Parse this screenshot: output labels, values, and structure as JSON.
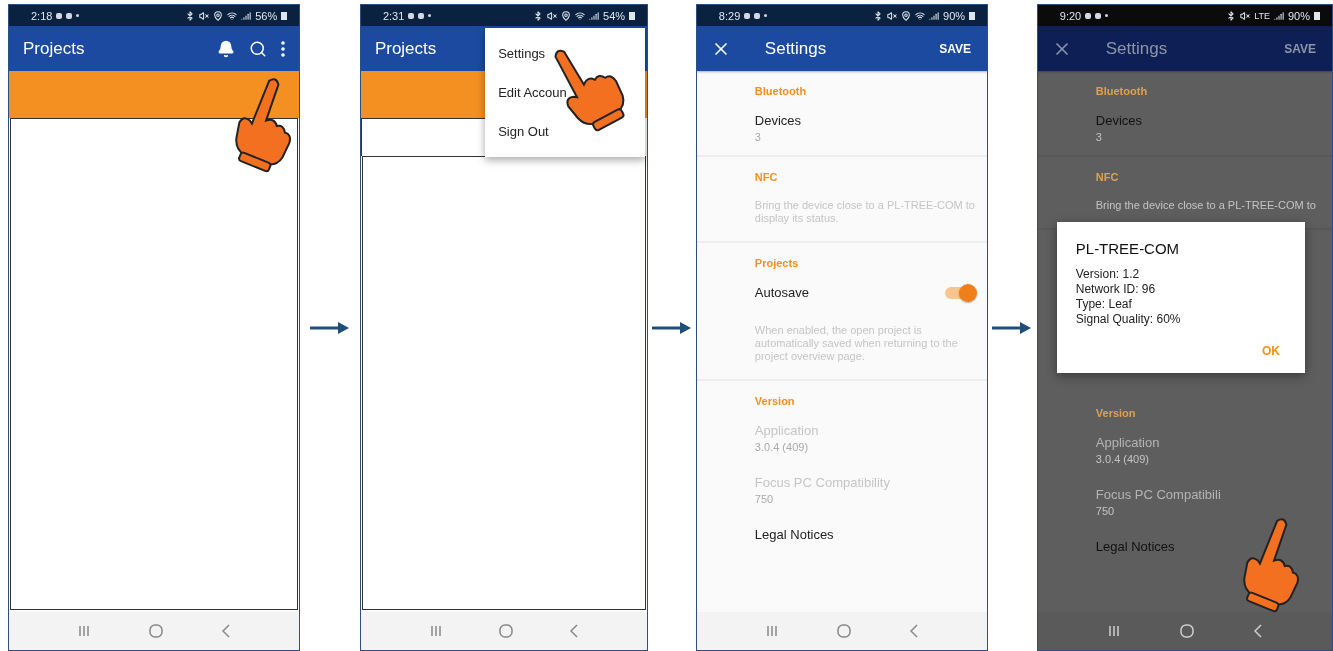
{
  "panels": [
    {
      "kind": "projects",
      "status": {
        "time": "2:18",
        "battery": "56%",
        "network": {
          "kind": "wifi"
        },
        "location": true
      },
      "title": "Projects",
      "toolbar_icons": true,
      "menu_open": false
    },
    {
      "kind": "projects",
      "status": {
        "time": "2:31",
        "battery": "54%",
        "network": {
          "kind": "wifi"
        },
        "location": true
      },
      "title": "Projects",
      "toolbar_icons": false,
      "menu_open": true,
      "menu": [
        {
          "label": "Settings"
        },
        {
          "label": "Edit Accoun"
        },
        {
          "label": "Sign Out"
        }
      ]
    },
    {
      "kind": "settings",
      "dimmed": false,
      "status": {
        "time": "8:29",
        "battery": "90%",
        "network": {
          "kind": "wifi"
        },
        "location": true
      },
      "title": "Settings",
      "save": "SAVE",
      "blocks": [
        {
          "kind": "section",
          "header": "Bluetooth",
          "items": [
            {
              "kind": "value",
              "title": "Devices",
              "value": "3",
              "disabled": false
            }
          ]
        },
        {
          "kind": "section",
          "header": "NFC",
          "items": [
            {
              "kind": "note",
              "text": "Bring the device close to a PL-TREE-COM to display its status."
            }
          ]
        },
        {
          "kind": "section",
          "header": "Projects",
          "items": [
            {
              "kind": "switch",
              "title": "Autosave",
              "on": true
            },
            {
              "kind": "note",
              "text": "When enabled, the open project is automatically saved when returning to the project overview page."
            }
          ]
        },
        {
          "kind": "section",
          "header": "Version",
          "items": [
            {
              "kind": "value",
              "title": "Application",
              "value": "3.0.4 (409)",
              "disabled": true
            },
            {
              "kind": "value",
              "title": "Focus PC Compatibility",
              "value": "750",
              "disabled": true
            },
            {
              "kind": "value",
              "title": "Legal Notices",
              "disabled": false
            }
          ]
        }
      ]
    },
    {
      "kind": "settings",
      "dimmed": true,
      "status": {
        "time": "9:20",
        "battery": "90%",
        "network": {
          "kind": "lte",
          "label": "LTE"
        },
        "location": false
      },
      "title": "Settings",
      "save": "SAVE",
      "blocks": [
        {
          "kind": "section",
          "header": "Bluetooth",
          "items": [
            {
              "kind": "value",
              "title": "Devices",
              "value": "3",
              "disabled": false
            }
          ]
        },
        {
          "kind": "section",
          "header": "NFC",
          "items": [
            {
              "kind": "note",
              "text": "Bring the device close to a PL-TREE-COM to"
            }
          ]
        },
        {
          "kind": "dialog",
          "title": "PL-TREE-COM",
          "lines": [
            "Version: 1.2",
            "Network ID: 96",
            "Type: Leaf",
            "Signal Quality: 60%"
          ],
          "button": "OK"
        },
        {
          "kind": "section",
          "header": "Version",
          "items": [
            {
              "kind": "value",
              "title": "Application",
              "value": "3.0.4 (409)",
              "disabled": true
            },
            {
              "kind": "value",
              "title": "Focus PC Compatibili",
              "value": "750",
              "disabled": true
            },
            {
              "kind": "value",
              "title": "Legal Notices",
              "disabled": false
            }
          ]
        }
      ]
    }
  ]
}
